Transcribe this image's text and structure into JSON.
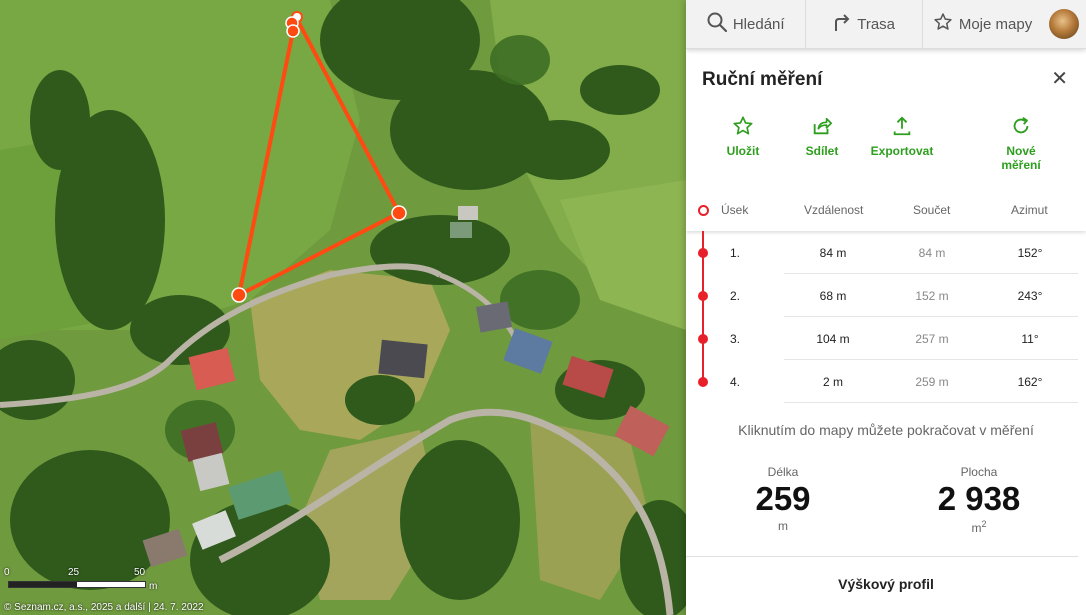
{
  "map": {
    "scale": {
      "labels": [
        "0",
        "25",
        "50"
      ],
      "unit": "m"
    },
    "copyright": "© Seznam.cz, a.s., 2025 a další | 24. 7. 2022"
  },
  "topbar": {
    "search_label": "Hledání",
    "route_label": "Trasa",
    "mymaps_label": "Moje mapy"
  },
  "panel": {
    "title": "Ruční měření",
    "close_label": "✕",
    "actions": [
      {
        "label": "Uložit",
        "icon": "star-icon"
      },
      {
        "label": "Sdílet",
        "icon": "share-icon"
      },
      {
        "label": "Exportovat",
        "icon": "export-icon"
      },
      {
        "label": "Nové měření",
        "icon": "refresh-icon"
      }
    ],
    "table": {
      "headers": [
        "Úsek",
        "Vzdálenost",
        "Součet",
        "Azimut"
      ],
      "rows": [
        {
          "segment": "1.",
          "distance": "84 m",
          "sum": "84 m",
          "azimuth": "152°"
        },
        {
          "segment": "2.",
          "distance": "68 m",
          "sum": "152 m",
          "azimuth": "243°"
        },
        {
          "segment": "3.",
          "distance": "104 m",
          "sum": "257 m",
          "azimuth": "11°"
        },
        {
          "segment": "4.",
          "distance": "2 m",
          "sum": "259 m",
          "azimuth": "162°"
        }
      ]
    },
    "hint": "Kliknutím do mapy můžete pokračovat v měření",
    "length": {
      "label": "Délka",
      "value": "259",
      "unit": "m"
    },
    "area": {
      "label": "Plocha",
      "value": "2 938",
      "unit": "m",
      "unit_sup": "2"
    },
    "profile_title": "Výškový profil"
  },
  "colors": {
    "accent_green": "#2e9e1e",
    "measure_red": "#e8202a",
    "map_line": "#ff4a12"
  }
}
